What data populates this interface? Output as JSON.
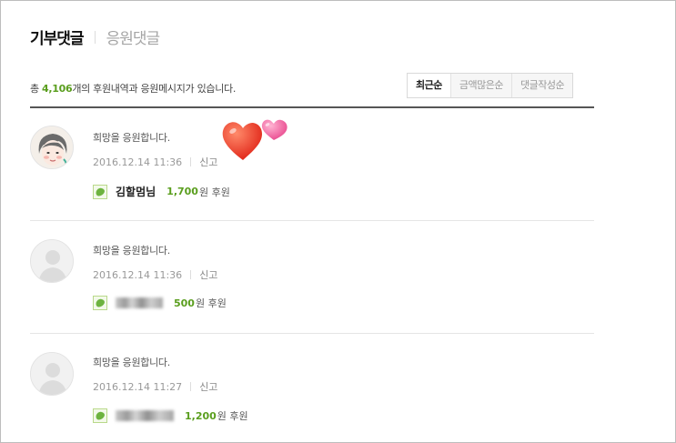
{
  "tabs": {
    "active": "기부댓글",
    "inactive": "응원댓글"
  },
  "summary": {
    "prefix": "총 ",
    "count": "4,106",
    "suffix": "개의 후원내역과 응원메시지가 있습니다."
  },
  "sort": [
    "최근순",
    "금액많은순",
    "댓글작성순"
  ],
  "comments": [
    {
      "message": "희망을 응원합니다.",
      "date": "2016.12.14 11:36",
      "report": "신고",
      "donor": "김할멈님",
      "amount": "1,700",
      "amount_unit": "원 후원",
      "avatar": "grandma-avatar"
    },
    {
      "message": "희망을 응원합니다.",
      "date": "2016.12.14 11:36",
      "report": "신고",
      "donor": "",
      "amount": "500",
      "amount_unit": "원 후원",
      "avatar": "default-avatar"
    },
    {
      "message": "희망을 응원합니다.",
      "date": "2016.12.14 11:27",
      "report": "신고",
      "donor": "",
      "amount": "1,200",
      "amount_unit": "원 후원",
      "avatar": "default-avatar"
    }
  ],
  "colors": {
    "accent": "#5a9e1e",
    "heart_red": "#e8342a",
    "heart_pink": "#f06aa3"
  }
}
